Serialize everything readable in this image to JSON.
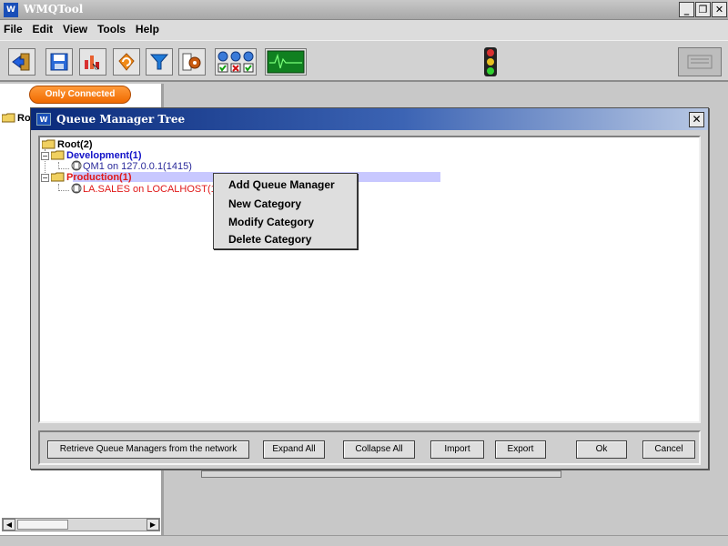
{
  "app": {
    "title": "WMQTool",
    "icon_text": "W",
    "window_controls": {
      "minimize": "_",
      "restore": "❐",
      "close": "✕"
    }
  },
  "menubar": {
    "items": [
      "File",
      "Edit",
      "View",
      "Tools",
      "Help"
    ]
  },
  "toolbar": {
    "buttons": [
      "exit-icon",
      "save-icon",
      "chart-icon",
      "refresh-icon",
      "filter-icon",
      "settings-icon",
      "status-grid-icon",
      "monitor-icon"
    ],
    "traffic_light": "traffic-light-icon"
  },
  "sidepanel": {
    "filter_button": "Only Connected",
    "tree_fragment": "Ro"
  },
  "dialog": {
    "title": "Queue Manager Tree",
    "close": "✕",
    "tree": {
      "root": "Root(2)",
      "categories": [
        {
          "label": "Development(1)",
          "color": "#1212c8",
          "queue_managers": [
            {
              "label": "QM1  on 127.0.0.1(1415)",
              "color": "#2a2a9a"
            }
          ]
        },
        {
          "label": "Production(1)",
          "color": "#e01818",
          "queue_managers": [
            {
              "label": "LA.SALES  on LOCALHOST(1",
              "color": "#e01818"
            }
          ]
        }
      ]
    },
    "buttons": {
      "retrieve": "Retrieve Queue Managers from the network",
      "expand_all": "Expand All",
      "collapse_all": "Collapse All",
      "import": "Import",
      "export": "Export",
      "ok": "Ok",
      "cancel": "Cancel"
    }
  },
  "context_menu": {
    "items": [
      "Add Queue Manager",
      "New Category",
      "Modify Category",
      "Delete Category"
    ]
  },
  "colors": {
    "dialog_title_start": "#0a2a7a",
    "dialog_title_end": "#b8c8e4",
    "only_connected": "#f06a00",
    "selection": "#c8c8ff"
  }
}
